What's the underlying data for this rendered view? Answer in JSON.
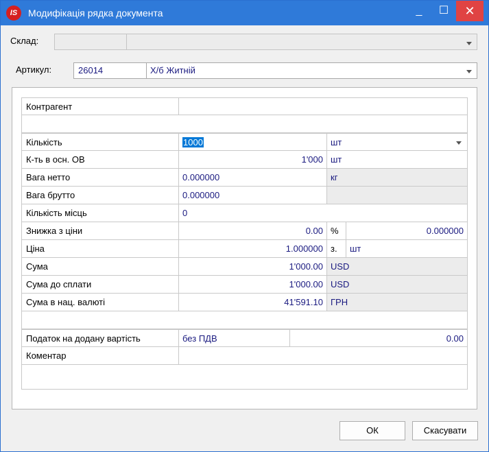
{
  "window": {
    "title": "Модифікація рядка документа",
    "logo": "IS"
  },
  "controls": {
    "minimize": "_",
    "maximize": "☐",
    "close": "✕"
  },
  "sklad": {
    "label": "Склад:",
    "code": "",
    "name": ""
  },
  "artikul": {
    "label": "Артикул:",
    "code": "26014",
    "name": "Х/б Житній"
  },
  "grid": {
    "kontragent": {
      "label": "Контрагент",
      "value": ""
    },
    "kilkist": {
      "label": "Кількість",
      "value": "1000",
      "unit": "шт"
    },
    "kt_osn": {
      "label": "К-ть в осн. ОВ",
      "value": "1'000",
      "unit": "шт"
    },
    "vaha_netto": {
      "label": "Вага нетто",
      "value": "0.000000",
      "unit": "кг"
    },
    "vaha_brutto": {
      "label": "Вага брутто",
      "value": "0.000000",
      "unit": ""
    },
    "kilkist_mists": {
      "label": "Кількість місць",
      "value": "0"
    },
    "znyzhka": {
      "label": "Знижка з ціни",
      "value": "0.00",
      "unit": "%",
      "value2": "0.000000"
    },
    "tsina": {
      "label": "Ціна",
      "value": "1.000000",
      "unit": "з.",
      "unit2": "шт"
    },
    "suma": {
      "label": "Сума",
      "value": "1'000.00",
      "currency": "USD"
    },
    "suma_splaty": {
      "label": "Сума до сплати",
      "value": "1'000.00",
      "currency": "USD"
    },
    "suma_nats": {
      "label": "Сума в нац. валюті",
      "value": "41'591.10",
      "currency": "ГРН"
    },
    "podatok": {
      "label": "Податок на додану вартість",
      "value": "без ПДВ",
      "amount": "0.00"
    },
    "komentar": {
      "label": "Коментар",
      "value": ""
    }
  },
  "buttons": {
    "ok": "ОК",
    "cancel": "Скасувати"
  }
}
